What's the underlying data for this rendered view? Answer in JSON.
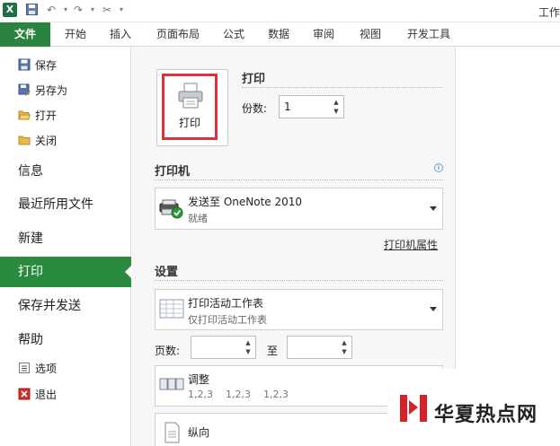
{
  "window": {
    "title": "工作"
  },
  "ribbon": {
    "tabs": [
      "文件",
      "开始",
      "插入",
      "页面布局",
      "公式",
      "数据",
      "审阅",
      "视图",
      "开发工具"
    ],
    "file_color": "#2a8440"
  },
  "backstage": {
    "commands": [
      {
        "label": "保存",
        "icon": "save-icon"
      },
      {
        "label": "另存为",
        "icon": "save-as-icon"
      },
      {
        "label": "打开",
        "icon": "open-folder-icon"
      },
      {
        "label": "关闭",
        "icon": "close-folder-icon"
      }
    ],
    "nav": [
      "信息",
      "最近所用文件",
      "新建",
      "打印",
      "保存并发送",
      "帮助"
    ],
    "active_nav": "打印",
    "bottom_commands": [
      {
        "label": "选项",
        "icon": "options-icon"
      },
      {
        "label": "退出",
        "icon": "exit-icon"
      }
    ]
  },
  "print": {
    "section_title": "打印",
    "button_label": "打印",
    "copies_label": "份数:",
    "copies_value": "1",
    "printer_title": "打印机",
    "printer_name": "发送至 OneNote 2010",
    "printer_status": "就绪",
    "printer_properties_link": "打印机属性",
    "settings_title": "设置",
    "scope_main": "打印活动工作表",
    "scope_sub": "仅打印活动工作表",
    "pages_label": "页数:",
    "to_label": "至",
    "collate_main": "调整",
    "collate_sub": "1,2,3    1,2,3    1,2,3",
    "orientation_main": "纵向"
  },
  "watermark": {
    "text": "华夏热点网"
  }
}
